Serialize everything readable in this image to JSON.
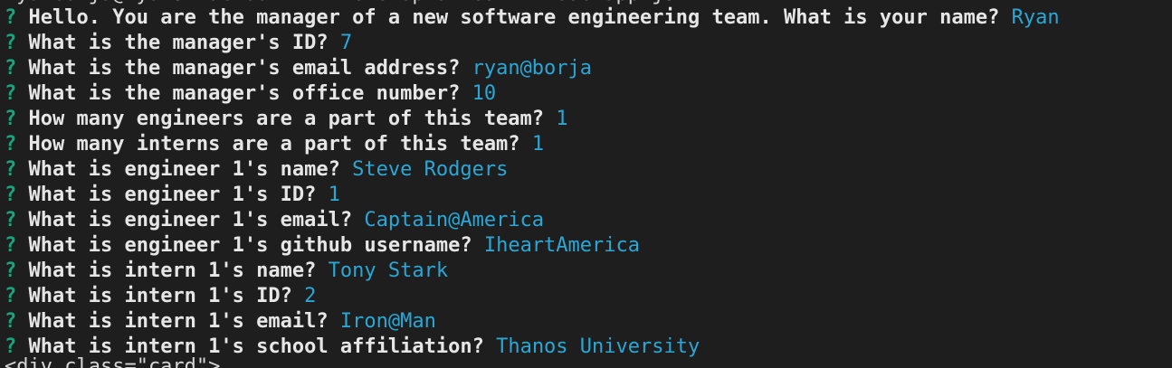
{
  "terminal": {
    "partial_top_line": "ryanborja@ryans-MacBook-Air Develop-a-Team % node app.js",
    "prompt_marker": "?",
    "prompts": [
      {
        "question": "Hello. You are the manager of a new software engineering team. What is your name?",
        "answer": "Ryan"
      },
      {
        "question": "What is the manager's ID?",
        "answer": "7"
      },
      {
        "question": "What is the manager's email address?",
        "answer": "ryan@borja"
      },
      {
        "question": "What is the manager's office number?",
        "answer": "10"
      },
      {
        "question": "How many engineers are a part of this team?",
        "answer": "1"
      },
      {
        "question": "How many interns are a part of this team?",
        "answer": "1"
      },
      {
        "question": "What is engineer 1's name?",
        "answer": "Steve Rodgers"
      },
      {
        "question": "What is engineer 1's ID?",
        "answer": "1"
      },
      {
        "question": "What is engineer 1's email?",
        "answer": "Captain@America"
      },
      {
        "question": "What is engineer 1's github username?",
        "answer": "IheartAmerica"
      },
      {
        "question": "What is intern 1's name?",
        "answer": "Tony Stark"
      },
      {
        "question": "What is intern 1's ID?",
        "answer": "2"
      },
      {
        "question": "What is intern 1's email?",
        "answer": "Iron@Man"
      },
      {
        "question": "What is intern 1's school affiliation?",
        "answer": "Thanos University"
      }
    ],
    "partial_bottom_line": "<div class=\"card\">"
  },
  "colors": {
    "background": "#1e1e1e",
    "prompt_marker": "#18a57a",
    "question_text": "#e6e6e6",
    "answer_text": "#2aa7d6"
  }
}
